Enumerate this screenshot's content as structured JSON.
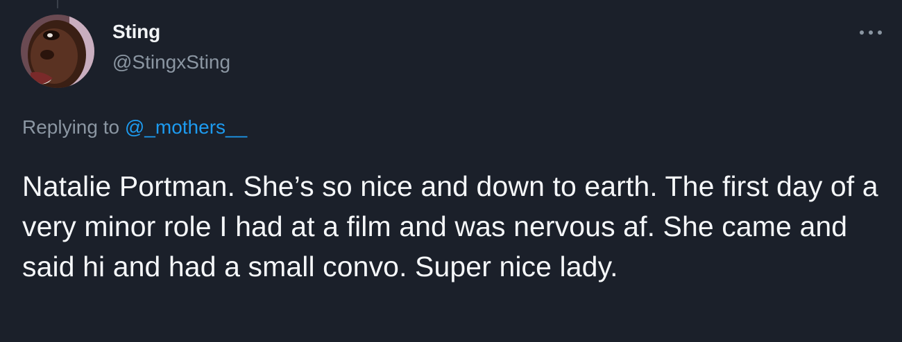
{
  "author": {
    "display_name": "Sting",
    "handle": "@StingxSting"
  },
  "reply": {
    "prefix": "Replying to ",
    "mention": "@_mothers__"
  },
  "tweet": {
    "text": "Natalie Portman. She’s so nice and down to earth. The first day of a very minor role I had at a film and was nervous af. She came and said hi and had a small convo. Super nice lady."
  },
  "icons": {
    "more": "more-options-icon"
  },
  "colors": {
    "background": "#1b202a",
    "primary_text": "#f5f7f9",
    "secondary_text": "#8b96a2",
    "link": "#1d9bf0"
  }
}
